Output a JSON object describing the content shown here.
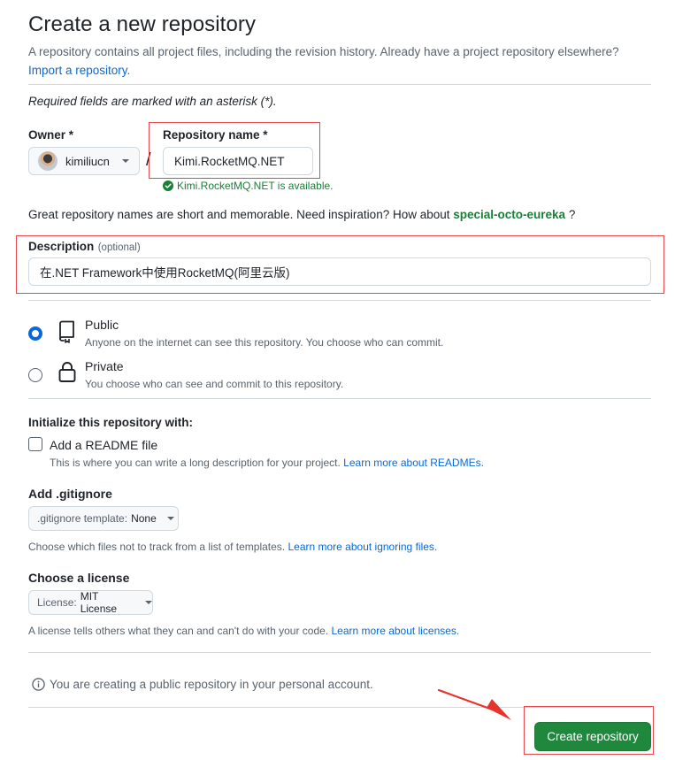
{
  "header": {
    "title": "Create a new repository",
    "subtitle": "A repository contains all project files, including the revision history. Already have a project repository elsewhere?",
    "import_link": "Import a repository."
  },
  "required_note": "Required fields are marked with an asterisk (*).",
  "owner": {
    "label": "Owner *",
    "value": "kimiliucn"
  },
  "slash": "/",
  "repo_name": {
    "label": "Repository name *",
    "value": "Kimi.RocketMQ.NET",
    "availability": "Kimi.RocketMQ.NET is available."
  },
  "inspiration": {
    "text": "Great repository names are short and memorable. Need inspiration? How about",
    "suggestion": "special-octo-eureka",
    "end": "?"
  },
  "description": {
    "label": "Description",
    "optional": "(optional)",
    "value": "在.NET Framework中使用RocketMQ(阿里云版)"
  },
  "visibility": {
    "public": {
      "label": "Public",
      "desc": "Anyone on the internet can see this repository. You choose who can commit.",
      "selected": true
    },
    "private": {
      "label": "Private",
      "desc": "You choose who can see and commit to this repository.",
      "selected": false
    }
  },
  "init": {
    "heading": "Initialize this repository with:",
    "readme_label": "Add a README file",
    "readme_desc": "This is where you can write a long description for your project.",
    "readme_link": "Learn more about READMEs."
  },
  "gitignore": {
    "heading": "Add .gitignore",
    "select_prefix": ".gitignore template:",
    "select_value": "None",
    "desc": "Choose which files not to track from a list of templates.",
    "link": "Learn more about ignoring files."
  },
  "license": {
    "heading": "Choose a license",
    "select_prefix": "License:",
    "select_value": "MIT License",
    "desc": "A license tells others what they can and can't do with your code.",
    "link": "Learn more about licenses."
  },
  "notice": "You are creating a public repository in your personal account.",
  "submit_label": "Create repository",
  "colors": {
    "primary_green": "#1f883d",
    "link_blue": "#0969da",
    "success_green": "#1a7f37",
    "annotation_red": "#e5484d"
  }
}
